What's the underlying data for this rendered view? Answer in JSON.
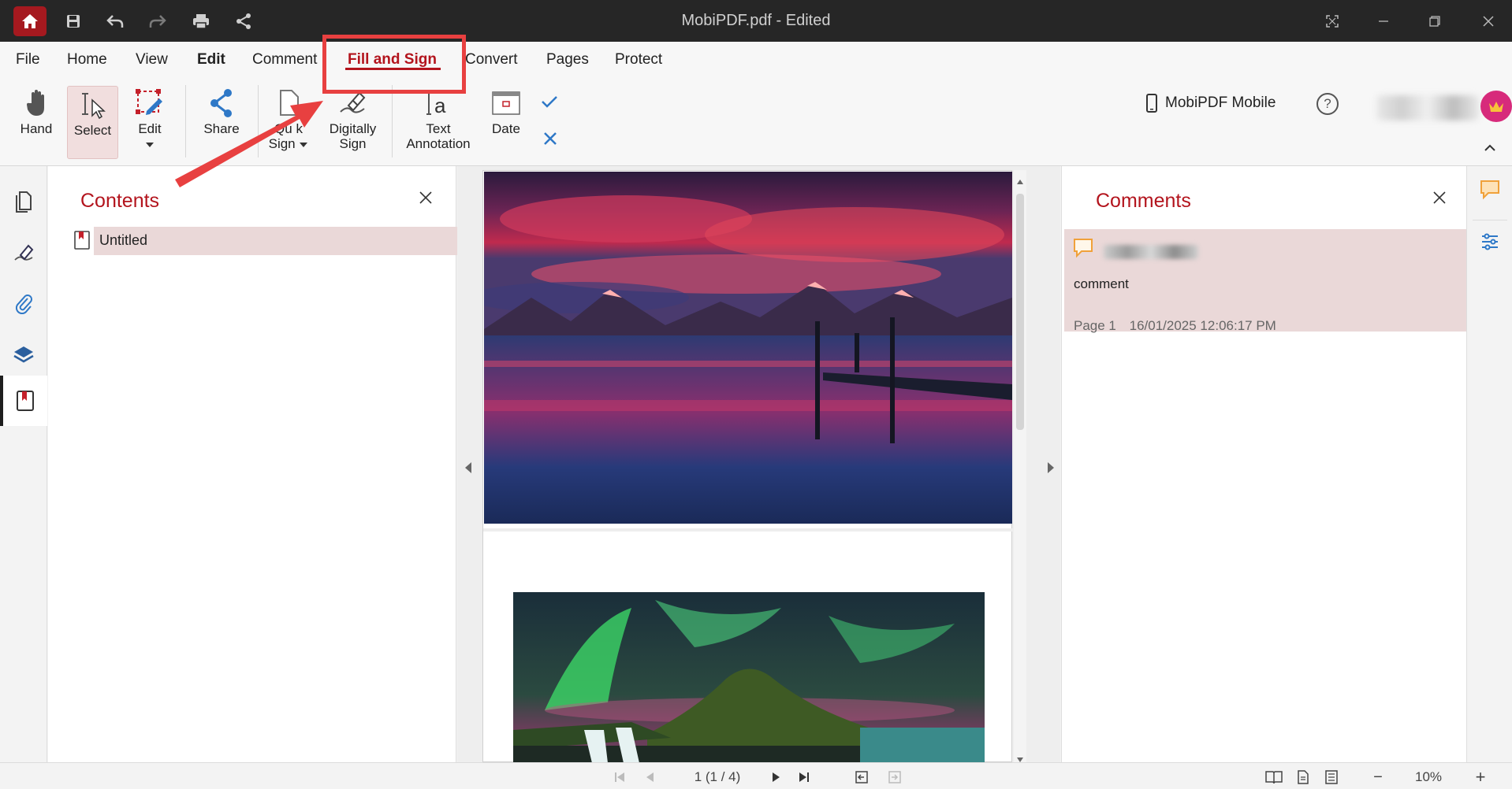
{
  "titlebar": {
    "title": "MobiPDF.pdf - Edited"
  },
  "menu": {
    "file": "File",
    "home": "Home",
    "view": "View",
    "edit": "Edit",
    "comment": "Comment",
    "fill_sign": "Fill and Sign",
    "convert": "Convert",
    "pages": "Pages",
    "protect": "Protect"
  },
  "toolbar": {
    "hand": "Hand",
    "select": "Select",
    "edit": "Edit",
    "share": "Share",
    "quick_sign_top": "Qu k",
    "quick_sign_bottom": "Sign",
    "digital_sign_top": "Digitally",
    "digital_sign_bottom": "Sign",
    "text_annot_top": "Text",
    "text_annot_bottom": "Annotation",
    "date": "Date"
  },
  "header_right": {
    "mobile": "MobiPDF Mobile",
    "help": "?"
  },
  "contents_panel": {
    "title": "Contents",
    "items": [
      {
        "label": "Untitled"
      }
    ]
  },
  "comments_panel": {
    "title": "Comments",
    "comments": [
      {
        "text": "comment",
        "page": "Page 1",
        "timestamp": "16/01/2025 12:06:17 PM"
      }
    ]
  },
  "statusbar": {
    "page_indicator": "1 (1 / 4)",
    "zoom": "10%",
    "zoom_out": "−",
    "zoom_in": "+"
  },
  "colors": {
    "accent": "#b3141d",
    "titlebar": "#262626",
    "highlight": "#e84040",
    "comment_icon": "#f0a13a"
  }
}
